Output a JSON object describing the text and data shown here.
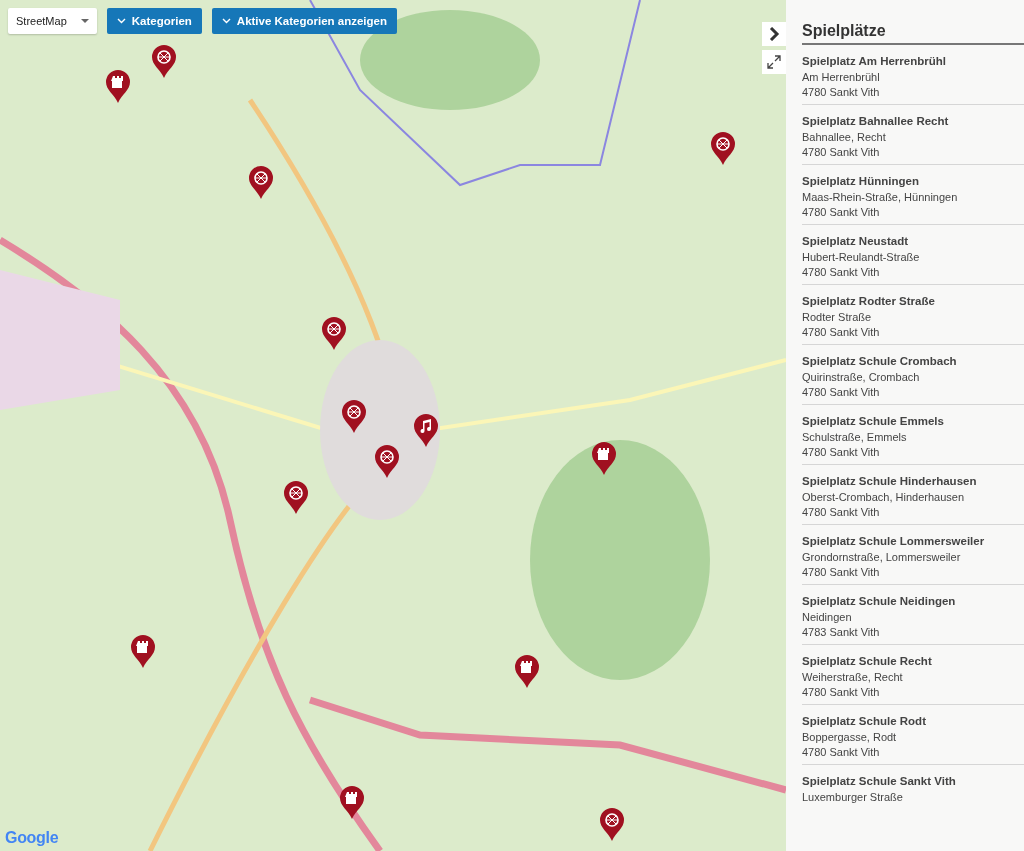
{
  "map_controls": {
    "layer_select": {
      "value": "StreetMap"
    },
    "buttons": [
      {
        "label": "Kategorien"
      },
      {
        "label": "Aktive Kategorien anzeigen"
      }
    ]
  },
  "markers": [
    {
      "kind": "ball"
    },
    {
      "kind": "castle"
    },
    {
      "kind": "ball"
    },
    {
      "kind": "ball"
    },
    {
      "kind": "ball"
    },
    {
      "kind": "music"
    },
    {
      "kind": "ball"
    },
    {
      "kind": "ball"
    },
    {
      "kind": "castle"
    },
    {
      "kind": "ball"
    },
    {
      "kind": "castle"
    },
    {
      "kind": "castle"
    },
    {
      "kind": "castle"
    },
    {
      "kind": "ball"
    }
  ],
  "attribution": "Google",
  "sidebar": {
    "title": "Spielplätze",
    "items": [
      {
        "name": "Spielplatz Am Herrenbrühl",
        "street": "Am Herrenbrühl",
        "city": "4780 Sankt Vith"
      },
      {
        "name": "Spielplatz Bahnallee Recht",
        "street": "Bahnallee, Recht",
        "city": "4780 Sankt Vith"
      },
      {
        "name": "Spielplatz Hünningen",
        "street": "Maas-Rhein-Straße, Hünningen",
        "city": "4780 Sankt Vith"
      },
      {
        "name": "Spielplatz Neustadt",
        "street": "Hubert-Reulandt-Straße",
        "city": "4780 Sankt Vith"
      },
      {
        "name": "Spielplatz Rodter Straße",
        "street": "Rodter Straße",
        "city": "4780 Sankt Vith"
      },
      {
        "name": "Spielplatz Schule Crombach",
        "street": "Quirinstraße, Crombach",
        "city": "4780 Sankt Vith"
      },
      {
        "name": "Spielplatz Schule Emmels",
        "street": "Schulstraße, Emmels",
        "city": "4780 Sankt Vith"
      },
      {
        "name": "Spielplatz Schule Hinderhausen",
        "street": "Oberst-Crombach, Hinderhausen",
        "city": "4780 Sankt Vith"
      },
      {
        "name": "Spielplatz Schule Lommersweiler",
        "street": "Grondornstraße, Lommersweiler",
        "city": "4780 Sankt Vith"
      },
      {
        "name": "Spielplatz Schule Neidingen",
        "street": "Neidingen",
        "city": "4783 Sankt Vith"
      },
      {
        "name": "Spielplatz Schule Recht",
        "street": "Weiherstraße, Recht",
        "city": "4780 Sankt Vith"
      },
      {
        "name": "Spielplatz Schule Rodt",
        "street": "Boppergasse, Rodt",
        "city": "4780 Sankt Vith"
      },
      {
        "name": "Spielplatz Schule Sankt Vith",
        "street": "Luxemburger Straße"
      }
    ]
  }
}
